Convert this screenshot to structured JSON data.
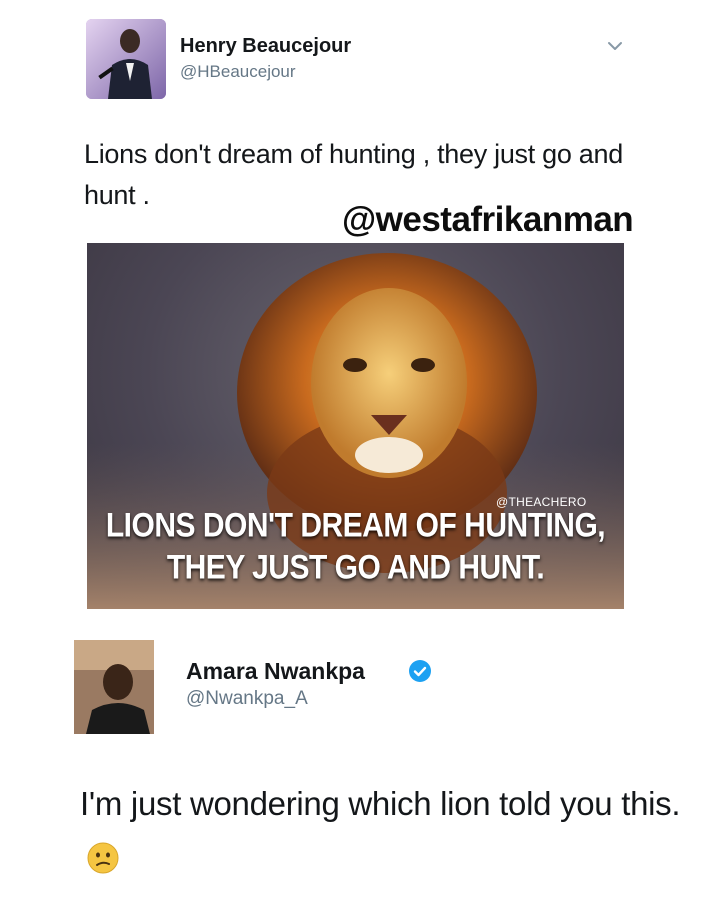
{
  "tweet1": {
    "author_name": "Henry Beaucejour",
    "author_handle": "@HBeaucejour",
    "text": "Lions don't dream of hunting , they just go and hunt .",
    "image": {
      "credit": "@THEACHERO",
      "caption_line1": "LIONS DON'T DREAM OF HUNTING,",
      "caption_line2": "THEY JUST GO AND HUNT."
    }
  },
  "watermark": "@westafrikanman",
  "tweet2": {
    "author_name": "Amara Nwankpa",
    "author_handle": "@Nwankpa_A",
    "verified": true,
    "text": "I'm just wondering which lion told you this.",
    "emoji": "confused-face"
  },
  "colors": {
    "text": "#14171a",
    "handle": "#657786",
    "verified_blue": "#1da1f2"
  }
}
